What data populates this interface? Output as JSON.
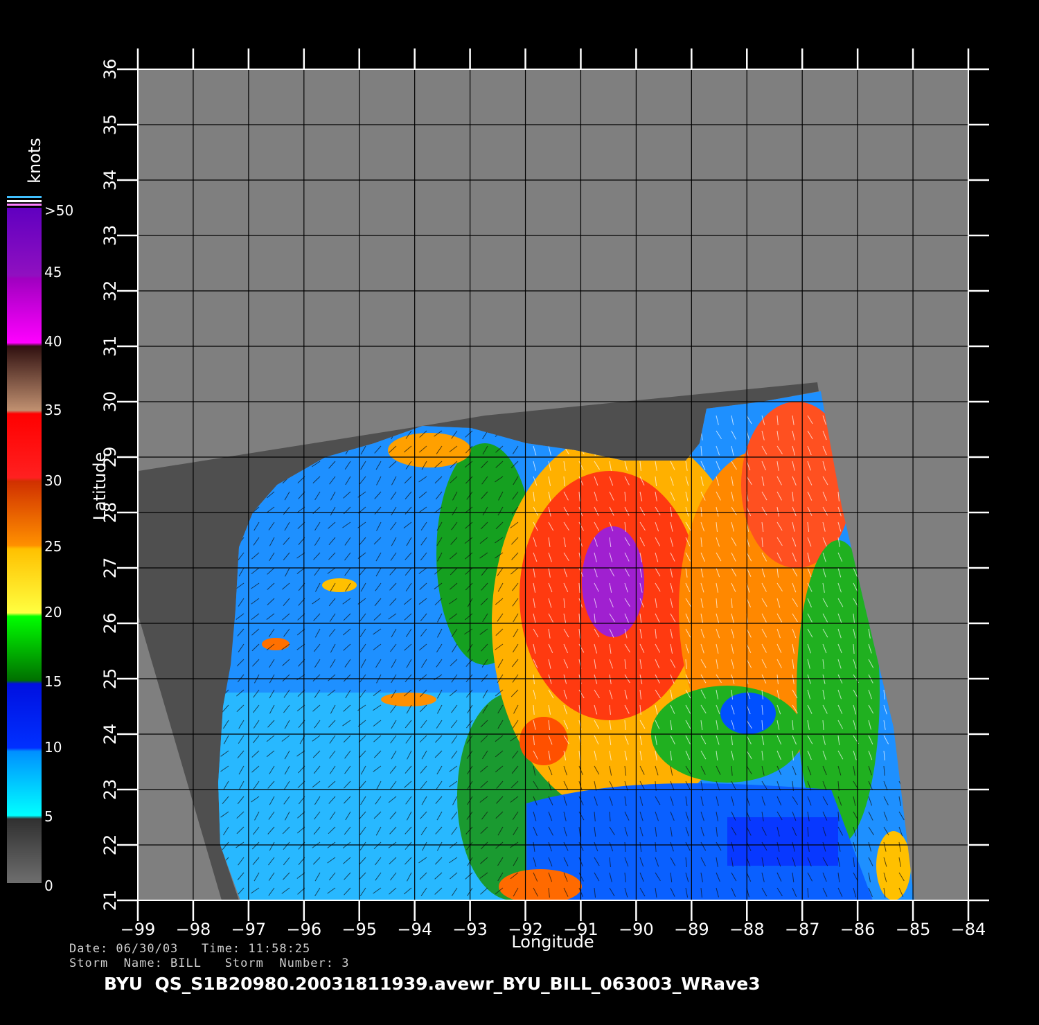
{
  "map": {
    "axes": {
      "lon_min": -99,
      "lon_max": -84,
      "lat_min": 21,
      "lat_max": 36,
      "xlabel": "Longitude",
      "ylabel": "Latitude",
      "lon_ticks": [
        "-99",
        "-98",
        "-97",
        "-96",
        "-95",
        "-94",
        "-93",
        "-92",
        "-91",
        "-90",
        "-89",
        "-88",
        "-87",
        "-86",
        "-85",
        "-84"
      ],
      "lat_ticks": [
        "21",
        "22",
        "23",
        "24",
        "25",
        "26",
        "27",
        "28",
        "29",
        "30",
        "31",
        "32",
        "33",
        "34",
        "35",
        "36"
      ],
      "grid": true
    },
    "colorbar": {
      "units": "knots",
      "labels": [
        "0",
        "5",
        "10",
        "15",
        "20",
        "25",
        "30",
        "35",
        "40",
        "45",
        ">50"
      ],
      "colors": [
        "#6b6b6b",
        "#00e8ff",
        "#0060ff",
        "#008800",
        "#ffff00",
        "#ffa000",
        "#ff4000",
        "#ff1010",
        "#c07050",
        "#ff00ff",
        "#7000c0"
      ]
    },
    "colors": {
      "background": "#000000",
      "no_data": "#7f7f7f",
      "land": "#4d4d4d"
    }
  },
  "footer": {
    "line1": "Date: 06/30/03   Time: 11:58:25",
    "line2": "Storm  Name: BILL   Storm  Number: 3",
    "title": "BYU  QS_S1B20980.20031811939.avewr_BYU_BILL_063003_WRave3"
  }
}
